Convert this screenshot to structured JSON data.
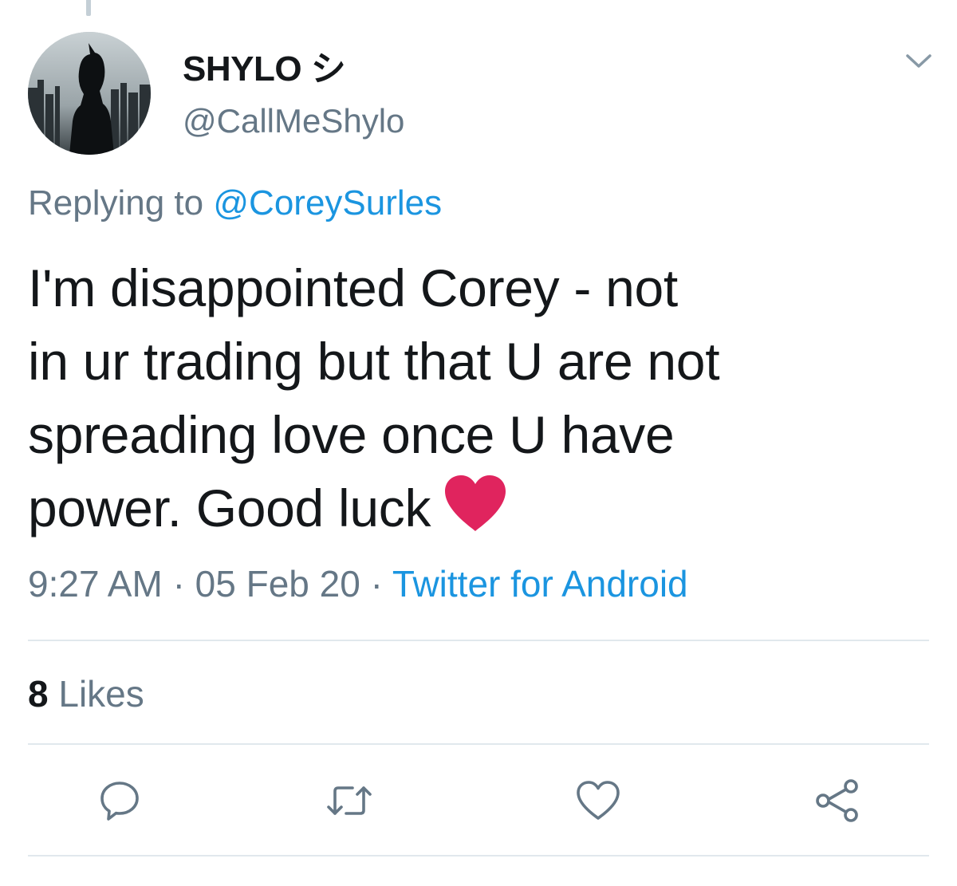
{
  "author": {
    "display_name": "SHYLO シ",
    "handle": "@CallMeShylo"
  },
  "reply": {
    "prefix": "Replying to",
    "mention": "@CoreySurles"
  },
  "tweet": {
    "lines": [
      "I'm disappointed Corey - not",
      "in ur trading but that U are not",
      "spreading love once U have",
      "power. Good luck"
    ],
    "emoji": "red-heart"
  },
  "meta": {
    "time": "9:27 AM",
    "separator": "·",
    "date": "05 Feb 20",
    "source": "Twitter for Android"
  },
  "stats": {
    "likes_count": "8",
    "likes_label": "Likes"
  },
  "actions": [
    "reply-icon",
    "retweet-icon",
    "like-icon",
    "share-icon"
  ],
  "colors": {
    "link": "#1b95e0",
    "secondary_text": "#657786",
    "divider": "#e1e8ed",
    "heart": "#e0245e"
  }
}
